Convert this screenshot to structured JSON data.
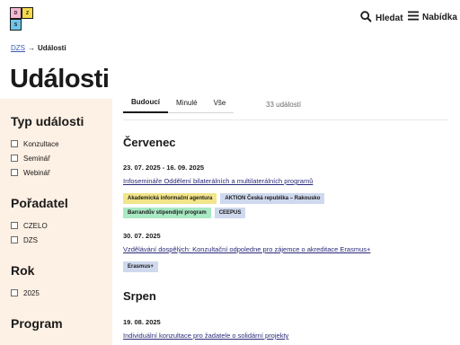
{
  "logo": {
    "letters": [
      "D",
      "Z",
      "S"
    ]
  },
  "header": {
    "search_label": "Hledat",
    "menu_label": "Nabídka"
  },
  "breadcrumb": {
    "home": "DZS",
    "separator": "→",
    "current": "Události"
  },
  "page_title": "Události",
  "sidebar": {
    "groups": [
      {
        "title": "Typ události",
        "options": [
          "Konzultace",
          "Seminář",
          "Webinář"
        ]
      },
      {
        "title": "Pořadatel",
        "options": [
          "CZELO",
          "DZS"
        ]
      },
      {
        "title": "Rok",
        "options": [
          "2025"
        ]
      },
      {
        "title": "Program",
        "options": []
      }
    ]
  },
  "tabs": {
    "items": [
      "Budoucí",
      "Minulé",
      "Vše"
    ],
    "active": "Budoucí"
  },
  "count_label": "33 událostí",
  "months": [
    {
      "name": "Červenec",
      "events": [
        {
          "date": "23. 07. 2025 - 16. 09. 2025",
          "title": "Infosemináře Oddělení bilaterálních a multilaterálních programů",
          "tags": [
            {
              "label": "Akademická informační agentura",
              "color": "#f2e58a"
            },
            {
              "label": "AKTION Česká republika – Rakousko",
              "color": "#cfd9ee"
            },
            {
              "label": "Barrandův stipendijní program",
              "color": "#a9e9c4"
            },
            {
              "label": "CEEPUS",
              "color": "#cfd9ee"
            }
          ]
        },
        {
          "date": "30. 07. 2025",
          "title": "Vzdělávání dospělých: Konzultační odpoledne pro zájemce o akreditace Erasmus+",
          "tags": [
            {
              "label": "Erasmus+",
              "color": "#cfd9ee"
            }
          ]
        }
      ]
    },
    {
      "name": "Srpen",
      "events": [
        {
          "date": "19. 08. 2025",
          "title": "Individuální konzultace pro žadatele o solidární projekty",
          "tags": []
        }
      ]
    }
  ]
}
